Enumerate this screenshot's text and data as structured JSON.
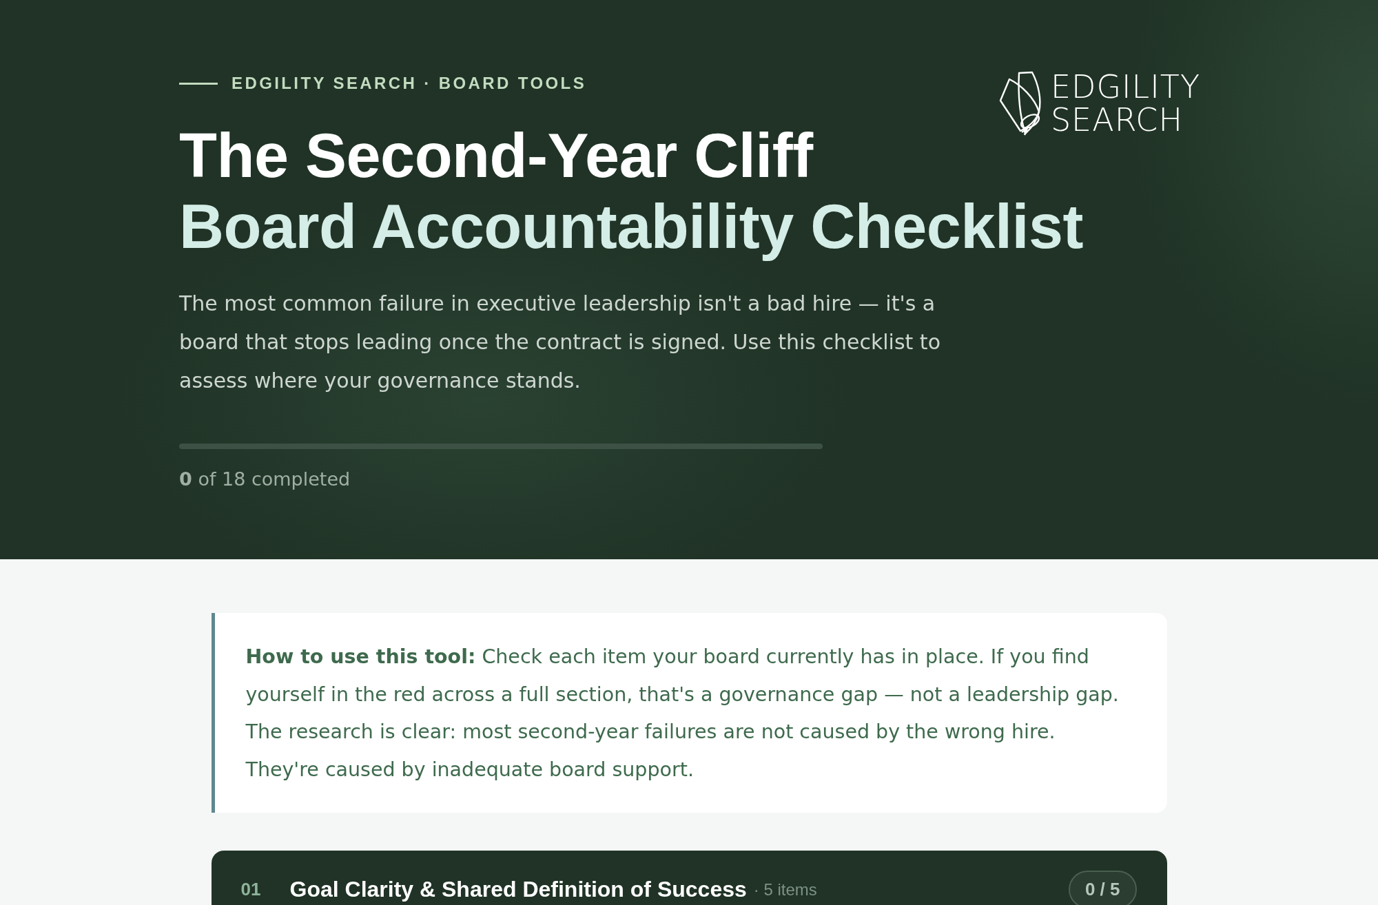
{
  "hero": {
    "eyebrow": "EDGILITY SEARCH · BOARD TOOLS",
    "logo": {
      "wordmark": [
        "EDGILITY",
        "SEARCH"
      ]
    },
    "title": "The Second-Year Cliff",
    "subtitle": "Board Accountability Checklist",
    "description": "The most common failure in executive leadership isn't a bad hire — it's a board that stops leading once the contract is signed. Use this checklist to assess where your governance stands.",
    "progress": {
      "level": 0,
      "count": "**0** of 18 completed"
    }
  },
  "callout": {
    "text": "**How to use this tool:** Check each item your board currently has in place. If you find yourself in the red across a full section, that's a governance gap — not a leadership gap. The research is clear: most second-year failures are not caused by the wrong hire. They're caused by inadequate board support."
  },
  "sections": [
    {
      "number": "01",
      "title": "Goal Clarity & Shared Definition of Success",
      "item_count": "· 5 items",
      "score": "0 / 5"
    }
  ]
}
